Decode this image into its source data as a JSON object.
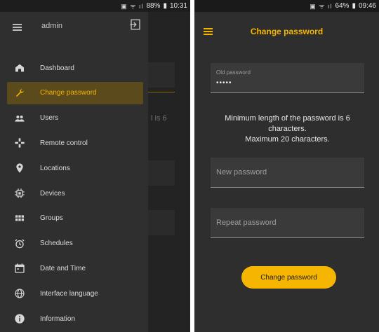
{
  "left_screen": {
    "status": {
      "percent": "88%",
      "time": "10:31"
    },
    "drawer": {
      "user": "admin",
      "items": [
        {
          "label": "Dashboard",
          "icon": "home-icon"
        },
        {
          "label": "Change password",
          "icon": "wrench-icon",
          "active": true
        },
        {
          "label": "Users",
          "icon": "users-icon"
        },
        {
          "label": "Remote control",
          "icon": "remote-control-icon"
        },
        {
          "label": "Locations",
          "icon": "location-pin-icon"
        },
        {
          "label": "Devices",
          "icon": "chip-icon"
        },
        {
          "label": "Groups",
          "icon": "grid-icon"
        },
        {
          "label": "Schedules",
          "icon": "alarm-clock-icon"
        },
        {
          "label": "Date and Time",
          "icon": "calendar-icon"
        },
        {
          "label": "Interface language",
          "icon": "globe-icon"
        },
        {
          "label": "Information",
          "icon": "info-icon"
        }
      ]
    },
    "background_text": "l is 6"
  },
  "right_screen": {
    "status": {
      "percent": "64%",
      "time": "09:46"
    },
    "title": "Change password",
    "old_password": {
      "label": "Old password",
      "value": "•••••"
    },
    "info_line1": "Minimum length of the password is 6",
    "info_line2": "characters.",
    "info_line3": "Maximum 20 characters.",
    "new_password_placeholder": "New password",
    "repeat_password_placeholder": "Repeat password",
    "submit_label": "Change password"
  },
  "colors": {
    "accent": "#f5b500",
    "background": "#2e2e2e",
    "active_item_background": "#5a4a1c"
  }
}
